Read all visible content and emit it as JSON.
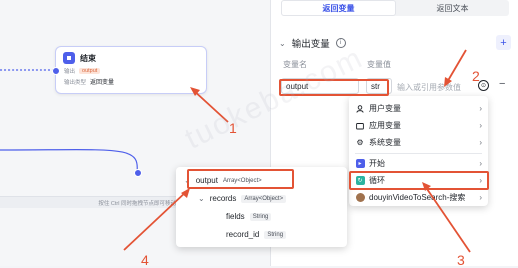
{
  "end_node": {
    "title": "结束",
    "output_label": "输出",
    "output_var": "output",
    "return_label": "输出类型",
    "return_value": "返回变量"
  },
  "status_bar": {
    "text": "按住 Ctrl 同时拖拽节点即可移动"
  },
  "panel": {
    "tabs": [
      {
        "label": "返回变量",
        "active": true
      },
      {
        "label": "返回文本",
        "active": false
      }
    ],
    "section_title": "输出变量",
    "columns": {
      "name": "变量名",
      "value": "变量值"
    },
    "row": {
      "name": "output",
      "type": "str",
      "placeholder": "输入或引用参数值"
    }
  },
  "dropdown": {
    "items": [
      {
        "label": "用户变量",
        "icon": "user-icon"
      },
      {
        "label": "应用变量",
        "icon": "folder-icon"
      },
      {
        "label": "系统变量",
        "icon": "gear-icon"
      },
      {
        "label": "开始",
        "icon": "start-node-icon"
      },
      {
        "label": "循环",
        "icon": "loop-node-icon"
      },
      {
        "label": "douyinVideoToSearch-搜索",
        "icon": "plugin-avatar-icon"
      }
    ]
  },
  "output_popup": {
    "rows": [
      {
        "name": "output",
        "type": "Array<Object>"
      },
      {
        "name": "records",
        "type": "Array<Object>"
      },
      {
        "name": "fields",
        "type": "String"
      },
      {
        "name": "record_id",
        "type": "String"
      }
    ]
  },
  "annotations": [
    "1",
    "2",
    "3",
    "4"
  ],
  "watermark": "tuokeba.com",
  "colors": {
    "accent": "#3d54e8",
    "annotation_red": "#e35335",
    "loop_green": "#2bb3a0"
  }
}
